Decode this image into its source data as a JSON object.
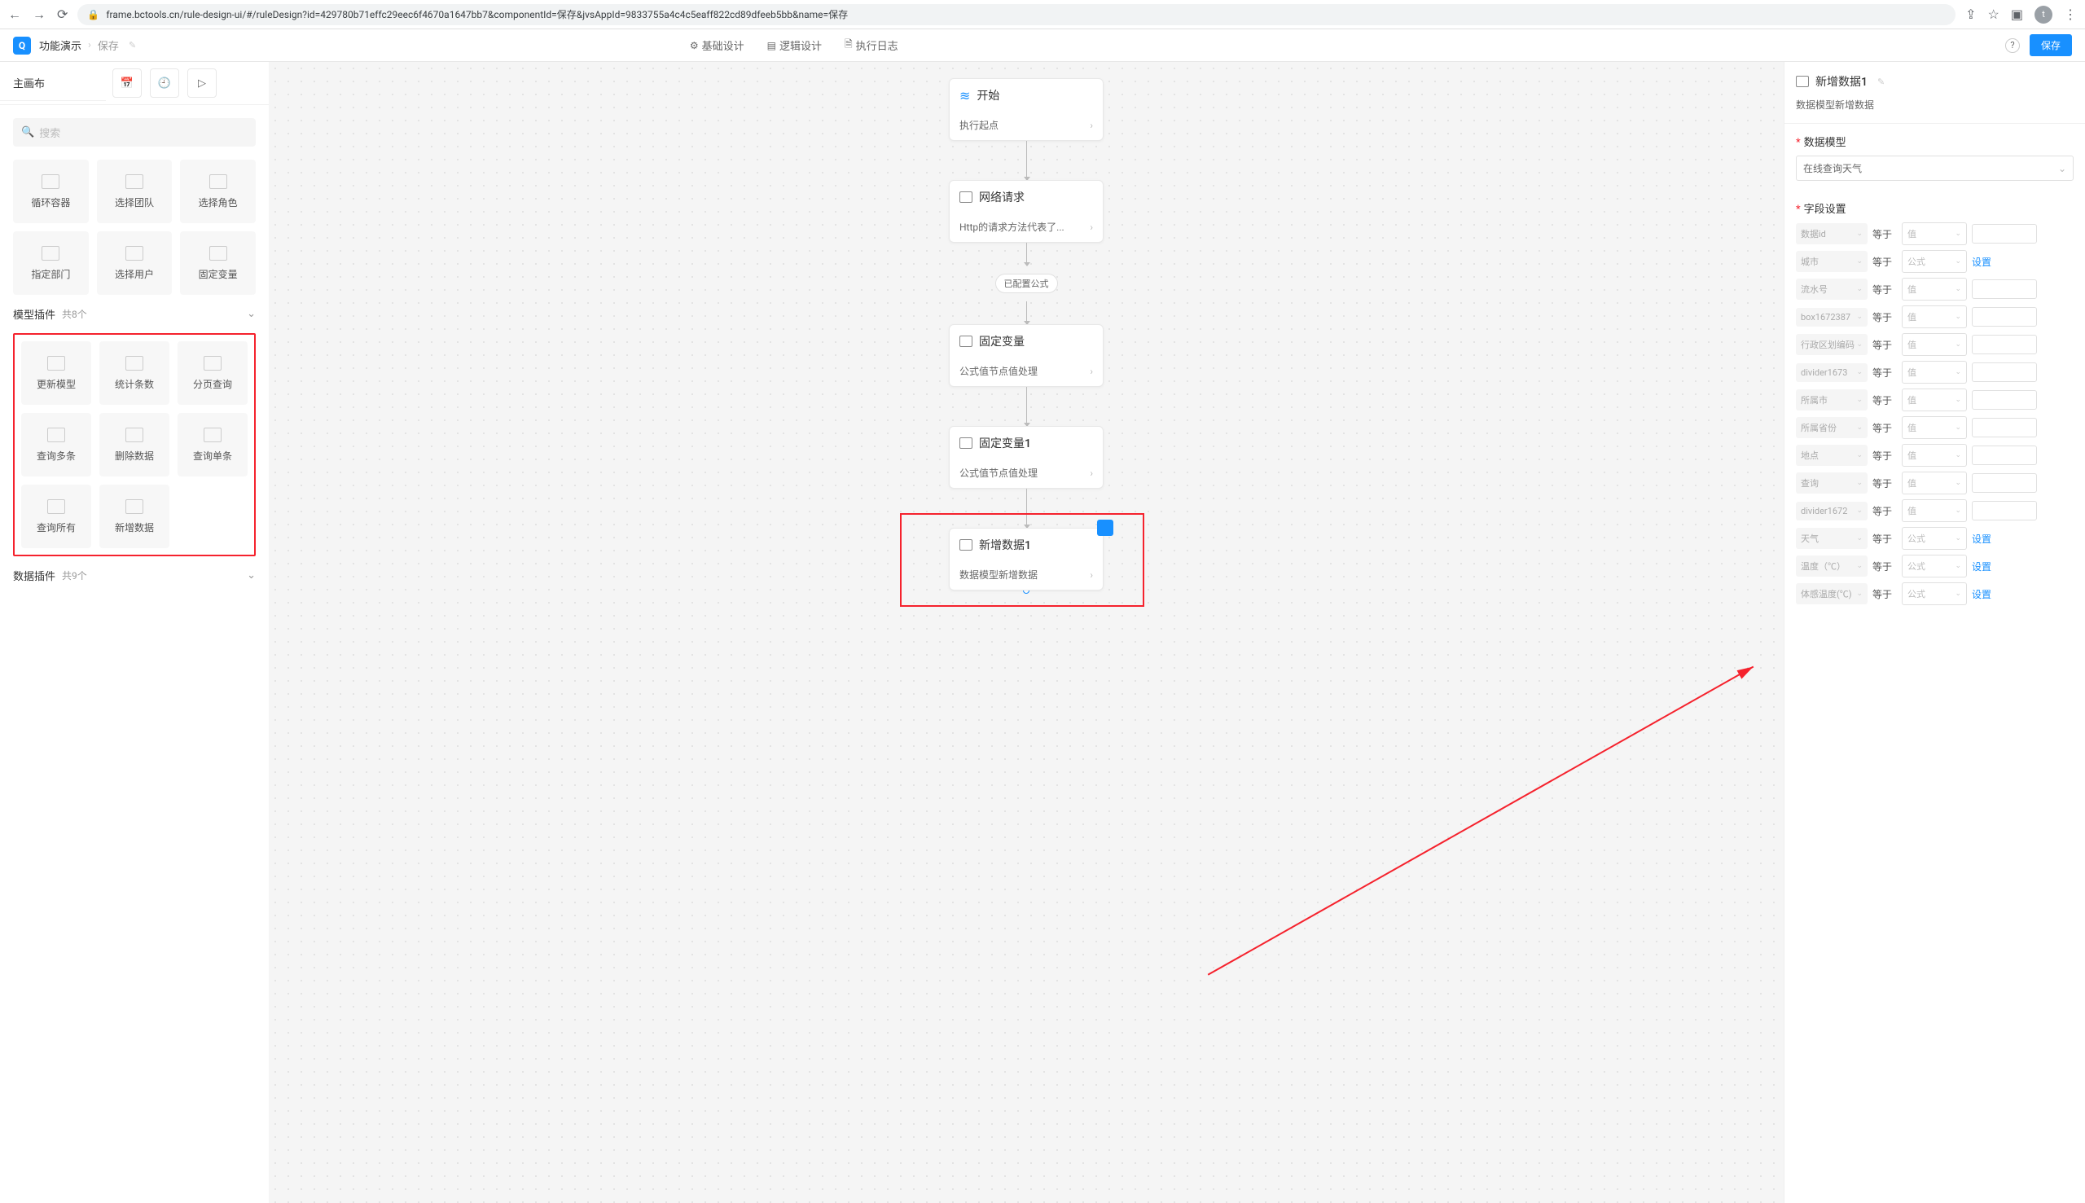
{
  "browser": {
    "url": "frame.bctools.cn/rule-design-ui/#/ruleDesign?id=429780b71effc29eec6f4670a1647bb7&componentId=保存&jvsAppId=9833755a4c4c5eaff822cd89dfeeb5bb&name=保存",
    "avatar_initial": "t"
  },
  "header": {
    "breadcrumb_root": "功能演示",
    "breadcrumb_current": "保存",
    "tabs": [
      {
        "icon": "⚙",
        "label": "基础设计"
      },
      {
        "icon": "▤",
        "label": "逻辑设计"
      },
      {
        "icon": "🗎",
        "label": "执行日志"
      }
    ],
    "save_label": "保存"
  },
  "left": {
    "canvas_tab": "主画布",
    "search_placeholder": "搜索",
    "group1_items": [
      {
        "label": "循环容器"
      },
      {
        "label": "选择团队"
      },
      {
        "label": "选择角色"
      },
      {
        "label": "指定部门"
      },
      {
        "label": "选择用户"
      },
      {
        "label": "固定变量"
      }
    ],
    "section_model": "模型插件",
    "section_model_count": "共8个",
    "model_items": [
      {
        "label": "更新模型"
      },
      {
        "label": "统计条数"
      },
      {
        "label": "分页查询"
      },
      {
        "label": "查询多条"
      },
      {
        "label": "删除数据"
      },
      {
        "label": "查询单条"
      },
      {
        "label": "查询所有"
      },
      {
        "label": "新增数据"
      }
    ],
    "section_data": "数据插件",
    "section_data_count": "共9个"
  },
  "flow": {
    "nodes": [
      {
        "title": "开始",
        "sub": "执行起点",
        "start": true
      },
      {
        "title": "网络请求",
        "sub": "Http的请求方法代表了..."
      },
      {
        "chip": "已配置公式"
      },
      {
        "title": "固定变量",
        "sub": "公式值节点值处理"
      },
      {
        "title": "固定变量1",
        "sub": "公式值节点值处理"
      },
      {
        "title": "新增数据1",
        "sub": "数据模型新增数据",
        "highlight": true
      }
    ]
  },
  "right": {
    "title": "新增数据1",
    "subtitle": "数据模型新增数据",
    "section_model_label": "数据模型",
    "model_value": "在线查询天气",
    "section_fields_label": "字段设置",
    "op_label": "等于",
    "val_placeholder": "值",
    "formula_label": "公式",
    "set_link": "设置",
    "fields": [
      {
        "name": "数据id",
        "type": "val"
      },
      {
        "name": "城市",
        "type": "formula"
      },
      {
        "name": "流水号",
        "type": "val"
      },
      {
        "name": "box1672387",
        "type": "val"
      },
      {
        "name": "行政区划编码",
        "type": "val"
      },
      {
        "name": "divider1673",
        "type": "val"
      },
      {
        "name": "所属市",
        "type": "val"
      },
      {
        "name": "所属省份",
        "type": "val"
      },
      {
        "name": "地点",
        "type": "val"
      },
      {
        "name": "查询",
        "type": "val"
      },
      {
        "name": "divider1672",
        "type": "val"
      },
      {
        "name": "天气",
        "type": "formula"
      },
      {
        "name": "温度（℃）",
        "type": "formula"
      },
      {
        "name": "体感温度(℃)",
        "type": "formula"
      }
    ]
  }
}
